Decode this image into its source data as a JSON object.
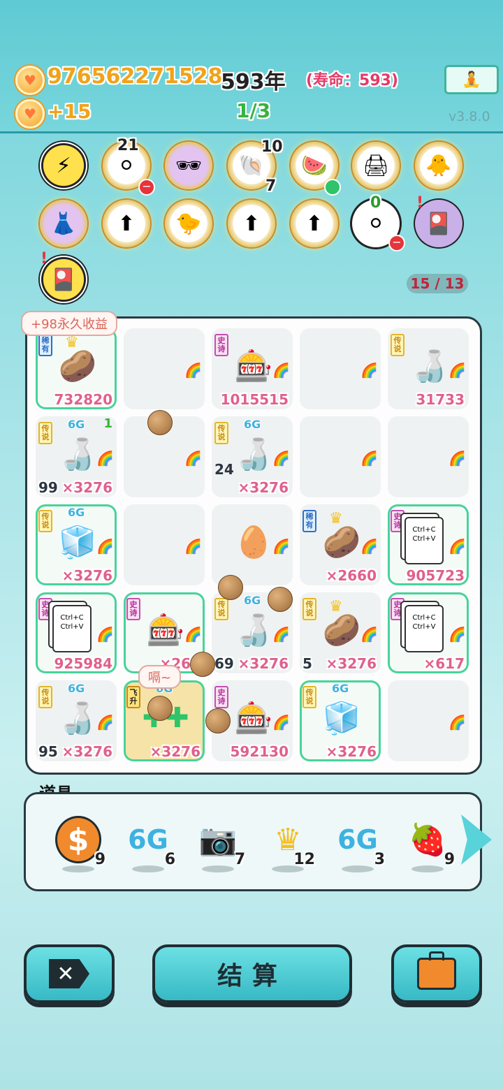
{
  "header": {
    "coins": "976562271528",
    "year": "593年",
    "lifespan": "(寿命：593)",
    "income": "+15",
    "ratio": "1/3",
    "version": "v3.8.0"
  },
  "buffs": {
    "counts": {
      "egg_tray_top": "21",
      "shell_top": "10",
      "shell_bottom": "7",
      "egg_tray_bottom": "0"
    }
  },
  "board": {
    "capacity": "15 / 13",
    "bubble_permanent": "+98永久收益",
    "bubble_hiccup": "嗝~",
    "tags": {
      "rare": "稀有",
      "legend": "传说",
      "epic": "史诗",
      "fly": "飞升"
    },
    "copy_text": "Ctrl+C\nCtrl+V",
    "six_g": "6G",
    "cells": {
      "r1c1": "732820",
      "r1c3": "1015515",
      "r1c5": "31733",
      "r2c1_left": "99",
      "r2c1_val": "×3276",
      "r2c1_corner": "1",
      "r2c3_mid": "24",
      "r2c3_val": "×3276",
      "r3c1_val": "×3276",
      "r3c4_val": "×2660",
      "r3c5_val": "905723",
      "r4c1_val": "925984",
      "r4c2_val": "×266",
      "r4c3_left": "69",
      "r4c3_val": "×3276",
      "r4c4_left": "5",
      "r4c4_val": "×3276",
      "r4c5_val": "×617",
      "r5c1_left": "95",
      "r5c1_val": "×3276",
      "r5c2_val": "×3276",
      "r5c3_val": "592130",
      "r5c4_val": "×3276"
    }
  },
  "tools": {
    "title": "道具",
    "items": [
      {
        "icon": "dollar-coin-icon",
        "count": "9"
      },
      {
        "icon": "6g-icon",
        "label": "6G",
        "count": "6"
      },
      {
        "icon": "camera-icon",
        "count": "7"
      },
      {
        "icon": "crown-icon",
        "count": "12"
      },
      {
        "icon": "6g-icon",
        "label": "6G",
        "count": "3"
      },
      {
        "icon": "strawberry-icon",
        "count": "9"
      }
    ]
  },
  "actions": {
    "settle_label": "结算"
  }
}
